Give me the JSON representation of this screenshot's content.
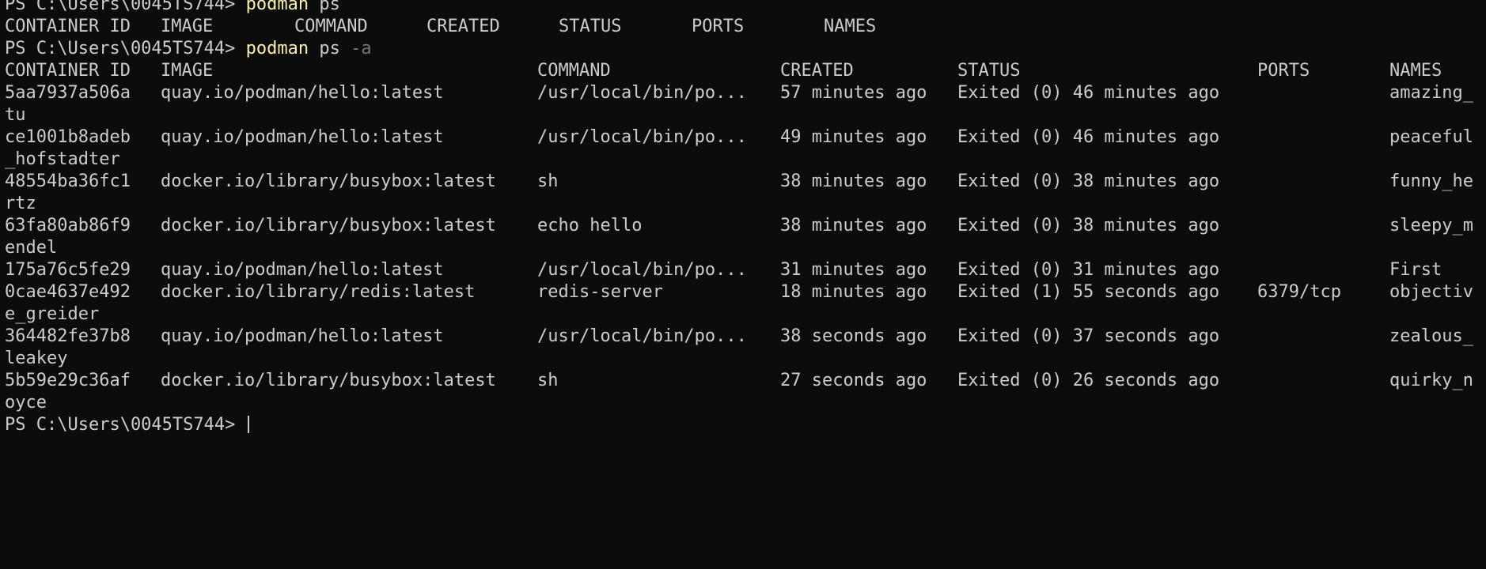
{
  "prompt": "PS C:\\Users\\0045TS744> ",
  "commands": [
    {
      "program": "podman",
      "args": "ps",
      "flag": ""
    },
    {
      "program": "podman",
      "args": "ps",
      "flag": "-a"
    }
  ],
  "ps_header": [
    "CONTAINER ID",
    "IMAGE",
    "COMMAND",
    "CREATED",
    "STATUS",
    "PORTS",
    "NAMES"
  ],
  "psa_header": [
    "CONTAINER ID",
    "IMAGE",
    "COMMAND",
    "CREATED",
    "STATUS",
    "PORTS",
    "NAMES"
  ],
  "containers": [
    {
      "id": "5aa7937a506a",
      "image": "quay.io/podman/hello:latest",
      "command": "/usr/local/bin/po...",
      "created": "57 minutes ago",
      "status": "Exited (0) 46 minutes ago",
      "ports": "",
      "name": "amazing_",
      "name_wrap": "tu"
    },
    {
      "id": "ce1001b8adeb",
      "image": "quay.io/podman/hello:latest",
      "command": "/usr/local/bin/po...",
      "created": "49 minutes ago",
      "status": "Exited (0) 46 minutes ago",
      "ports": "",
      "name": "peaceful",
      "name_wrap": "_hofstadter"
    },
    {
      "id": "48554ba36fc1",
      "image": "docker.io/library/busybox:latest",
      "command": "sh",
      "created": "38 minutes ago",
      "status": "Exited (0) 38 minutes ago",
      "ports": "",
      "name": "funny_he",
      "name_wrap": "rtz"
    },
    {
      "id": "63fa80ab86f9",
      "image": "docker.io/library/busybox:latest",
      "command": "echo hello",
      "created": "38 minutes ago",
      "status": "Exited (0) 38 minutes ago",
      "ports": "",
      "name": "sleepy_m",
      "name_wrap": "endel"
    },
    {
      "id": "175a76c5fe29",
      "image": "quay.io/podman/hello:latest",
      "command": "/usr/local/bin/po...",
      "created": "31 minutes ago",
      "status": "Exited (0) 31 minutes ago",
      "ports": "",
      "name": "First",
      "name_wrap": ""
    },
    {
      "id": "0cae4637e492",
      "image": "docker.io/library/redis:latest",
      "command": "redis-server",
      "created": "18 minutes ago",
      "status": "Exited (1) 55 seconds ago",
      "ports": "6379/tcp",
      "name": "objectiv",
      "name_wrap": "e_greider"
    },
    {
      "id": "364482fe37b8",
      "image": "quay.io/podman/hello:latest",
      "command": "/usr/local/bin/po...",
      "created": "38 seconds ago",
      "status": "Exited (0) 37 seconds ago",
      "ports": "",
      "name": "zealous_",
      "name_wrap": "leakey"
    },
    {
      "id": "5b59e29c36af",
      "image": "docker.io/library/busybox:latest",
      "command": "sh",
      "created": "27 seconds ago",
      "status": "Exited (0) 26 seconds ago",
      "ports": "",
      "name": "quirky_n",
      "name_wrap": "oyce"
    }
  ],
  "colors": {
    "background": "#0c0c0c",
    "text": "#cccccc",
    "command": "#f9f1a5",
    "flag": "#767676"
  }
}
